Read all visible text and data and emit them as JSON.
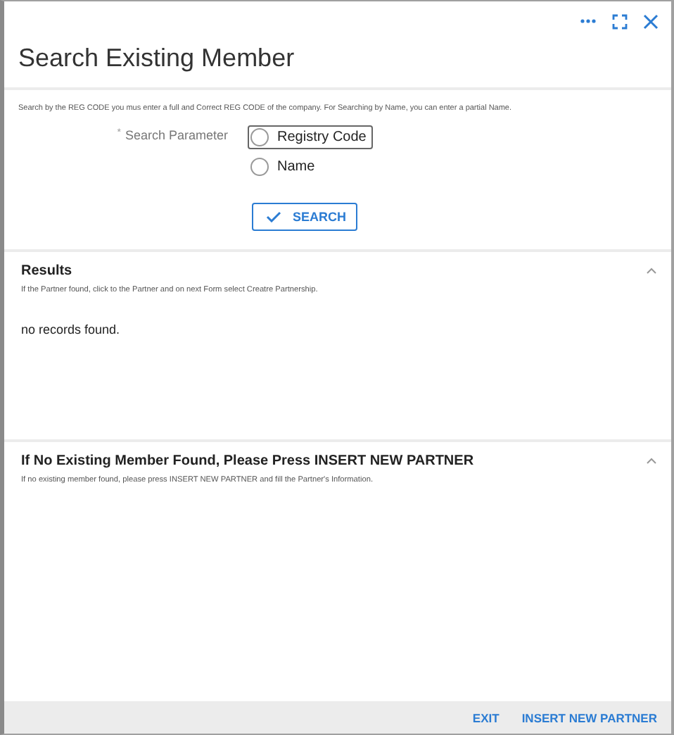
{
  "dialog": {
    "title": "Search Existing Member"
  },
  "search_form": {
    "hint": "Search by the REG CODE you mus enter a full and Correct REG CODE of the company. For Searching by Name, you can enter a partial Name.",
    "required_mark": "*",
    "label": "Search Parameter",
    "options": [
      {
        "label": "Registry Code",
        "selected": false,
        "focused": true
      },
      {
        "label": "Name",
        "selected": false,
        "focused": false
      }
    ],
    "button": "SEARCH"
  },
  "sections": [
    {
      "title": "Results",
      "expanded": true,
      "description": "If the Partner found, click to the Partner and on next Form select Creatre Partnership.",
      "message": "no records found."
    },
    {
      "title": "If No Existing Member Found, Please Press INSERT NEW PARTNER",
      "expanded": true,
      "description": "If no existing member found, please press INSERT NEW PARTNER and fill the Partner's Information."
    }
  ],
  "footer_buttons": [
    "EXIT",
    "INSERT NEW PARTNER"
  ]
}
